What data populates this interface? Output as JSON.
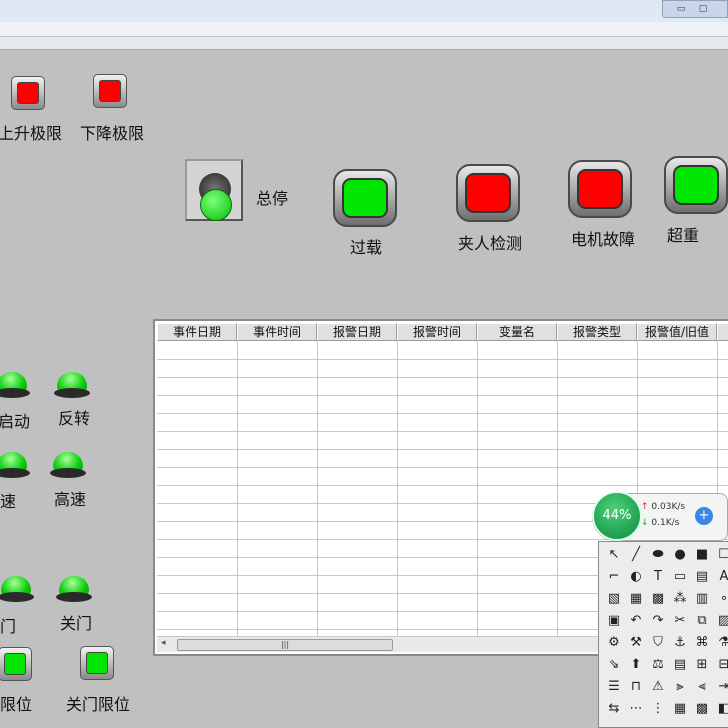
{
  "window": {
    "controls": [
      "▭",
      "▢"
    ]
  },
  "limits": [
    {
      "label": "上升极限",
      "state": "red"
    },
    {
      "label": "下降极限",
      "state": "red"
    }
  ],
  "estop": {
    "label": "总停",
    "state": "green"
  },
  "alarms": [
    {
      "label": "过载",
      "state": "green"
    },
    {
      "label": "夹人检测",
      "state": "red"
    },
    {
      "label": "电机故障",
      "state": "red"
    },
    {
      "label": "超重",
      "state": "green"
    }
  ],
  "indicators": [
    {
      "label": "预启动"
    },
    {
      "label": "反转"
    },
    {
      "label": "低速"
    },
    {
      "label": "高速"
    },
    {
      "label": "开门"
    },
    {
      "label": "关门"
    }
  ],
  "door_limits": [
    {
      "label": "门限位",
      "state": "green"
    },
    {
      "label": "关门限位",
      "state": "green"
    }
  ],
  "alarm_table": {
    "columns": [
      "事件日期",
      "事件时间",
      "报警日期",
      "报警时间",
      "变量名",
      "报警类型",
      "报警值/旧值",
      "恢"
    ],
    "rows": [],
    "scroll_grip": "|||"
  },
  "network": {
    "percent": "44%",
    "up": "0.03K/s",
    "down": "0.1K/s",
    "up_arrow": "↑",
    "down_arrow": "↓",
    "add_label": "+"
  },
  "palette": {
    "tools": [
      "↖",
      "╱",
      "⬬",
      "●",
      "■",
      "☐",
      "⌐",
      "◐",
      "T",
      "▭",
      "▤",
      "A",
      "▧",
      "▦",
      "▩",
      "⁂",
      "▥",
      "∘",
      "▣",
      "↶",
      "↷",
      "✂",
      "⧉",
      "▨",
      "⚙",
      "⚒",
      "⛉",
      "⚓",
      "⌘",
      "⚗",
      "⇘",
      "⬆",
      "⚖",
      "▤",
      "⊞",
      "⊟",
      "☰",
      "⊓",
      "⚠",
      "⫸",
      "⫷",
      "⇥",
      "⇆",
      "⋯",
      "⋮",
      "▦",
      "▩",
      "◧"
    ]
  },
  "colors": {
    "background": "#c0c0c0",
    "lamp_red": "#ff0000",
    "lamp_green": "#00e600"
  }
}
